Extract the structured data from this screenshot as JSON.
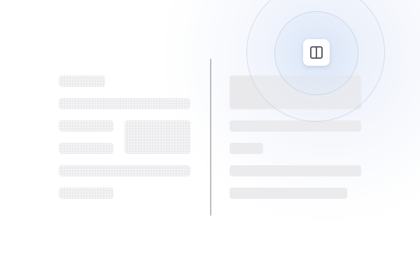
{
  "icons": {
    "split_view": "split-view-icon"
  },
  "colors": {
    "placeholder": "#ebebee",
    "divider": "#bdbdc2",
    "icon_stroke": "#4a4f5a",
    "glow": "#dfe7f6"
  },
  "panels": {
    "left": {
      "rows": [
        "title",
        "line",
        "label",
        "label",
        "line",
        "label"
      ],
      "has_image_placeholder": true
    },
    "right": {
      "rows": [
        "image",
        "line",
        "label",
        "line",
        "line"
      ]
    }
  }
}
